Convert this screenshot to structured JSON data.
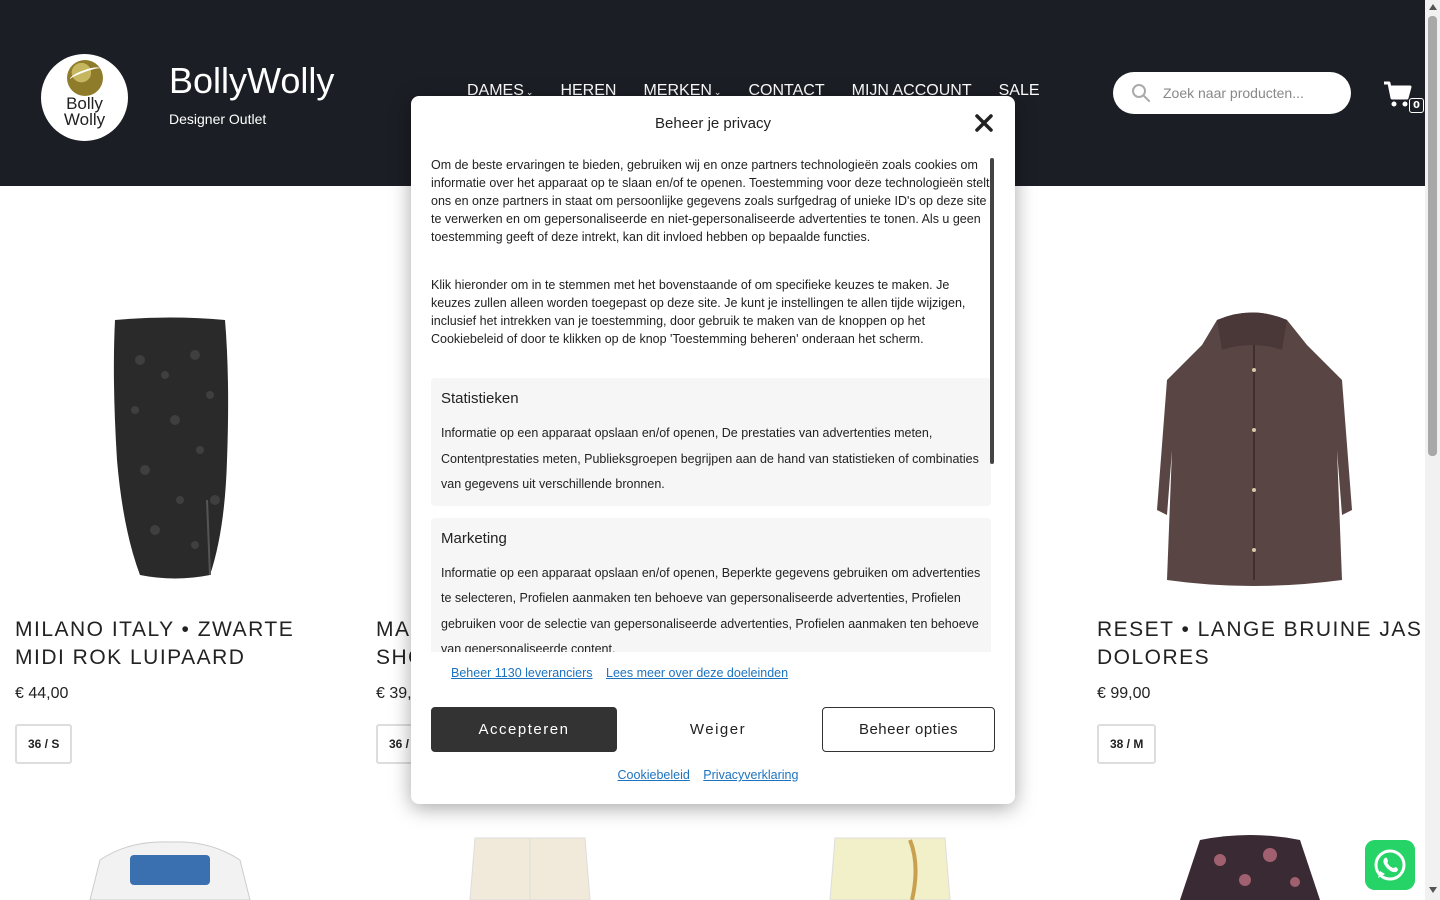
{
  "header": {
    "logo_text": "Bolly\nWolly",
    "site_title": "BollyWolly",
    "tagline": "Designer Outlet",
    "nav": [
      {
        "label": "DAMES",
        "has_dropdown": true
      },
      {
        "label": "HEREN",
        "has_dropdown": false
      },
      {
        "label": "MERKEN",
        "has_dropdown": true
      },
      {
        "label": "CONTACT",
        "has_dropdown": false
      },
      {
        "label": "MIJN ACCOUNT",
        "has_dropdown": false
      },
      {
        "label": "SALE",
        "has_dropdown": false
      }
    ],
    "search_placeholder": "Zoek naar producten...",
    "cart_count": "0",
    "bg_color": "#1b1e24"
  },
  "products": [
    {
      "title": "MILANO ITALY • ZWARTE MIDI ROK LUIPAARD",
      "price": "€ 44,00",
      "size": "36 / S"
    },
    {
      "title": "MA",
      "title_line2": "SHO",
      "price": "€ 39,",
      "size": "36 /"
    },
    {
      "title": "RESET • LANGE BRUINE JAS DOLORES",
      "price": "€ 99,00",
      "size": "38 / M"
    }
  ],
  "modal": {
    "title": "Beheer je privacy",
    "paragraph1": "Om de beste ervaringen te bieden, gebruiken wij en onze partners technologieën zoals cookies om informatie over het apparaat op te slaan en/of te openen. Toestemming voor deze technologieën stelt ons en onze partners in staat om persoonlijke gegevens zoals surfgedrag of unieke ID's op deze site te verwerken en om gepersonaliseerde en niet-gepersonaliseerde advertenties te tonen. Als u geen toestemming geeft of deze intrekt, kan dit invloed hebben op bepaalde functies.",
    "paragraph2": "Klik hieronder om in te stemmen met het bovenstaande of om specifieke keuzes te maken. Je keuzes zullen alleen worden toegepast op deze site. Je kunt je instellingen te allen tijde wijzigen, inclusief het intrekken van je toestemming, door gebruik te maken van de knoppen op het Cookiebeleid of door te klikken op de knop 'Toestemming beheren' onderaan het scherm.",
    "sections": [
      {
        "title": "Statistieken",
        "desc": "Informatie op een apparaat opslaan en/of openen, De prestaties van advertenties meten, Contentprestaties meten, Publieksgroepen begrijpen aan de hand van statistieken of combinaties van gegevens uit verschillende bronnen."
      },
      {
        "title": "Marketing",
        "desc": "Informatie op een apparaat opslaan en/of openen, Beperkte gegevens gebruiken om advertenties te selecteren, Profielen aanmaken ten behoeve van gepersonaliseerde advertenties, Profielen gebruiken voor de selectie van gepersonaliseerde advertenties, Profielen aanmaken ten behoeve van gepersonaliseerde content,"
      }
    ],
    "link_vendors": "Beheer 1130 leveranciers",
    "link_purposes": "Lees meer over deze doeleinden",
    "btn_accept": "Accepteren",
    "btn_deny": "Weiger",
    "btn_manage": "Beheer opties",
    "footer_link1": "Cookiebeleid",
    "footer_link2": "Privacyverklaring"
  }
}
